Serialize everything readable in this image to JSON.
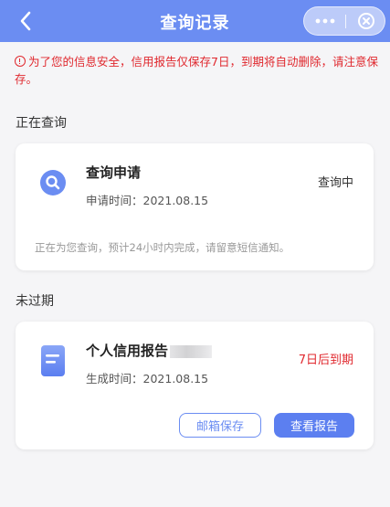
{
  "navbar": {
    "title": "查询记录",
    "back_icon": "chevron-left-icon",
    "more_icon": "more-dots-icon",
    "close_icon": "close-circle-icon",
    "bg_color": "#6b8df2"
  },
  "notice": {
    "icon": "info-circle-icon",
    "text": "为了您的信息安全，信用报告仅保存7日，到期将自动删除，请注意保存。",
    "color": "#e0282e"
  },
  "sections": {
    "querying": {
      "title": "正在查询",
      "card": {
        "icon": "search-icon",
        "title": "查询申请",
        "time_label": "申请时间：",
        "time_value": "2021.08.15",
        "status": "查询中",
        "footnote": "正在为您查询，预计24小时内完成，请留意短信通知。"
      }
    },
    "unexpired": {
      "title": "未过期",
      "card": {
        "icon": "document-icon",
        "title": "个人信用报告",
        "time_label": "生成时间：",
        "time_value": "2021.08.15",
        "status": "7日后到期",
        "status_color": "#e0282e",
        "buttons": {
          "email_save": "邮箱保存",
          "view_report": "查看报告"
        }
      }
    }
  }
}
